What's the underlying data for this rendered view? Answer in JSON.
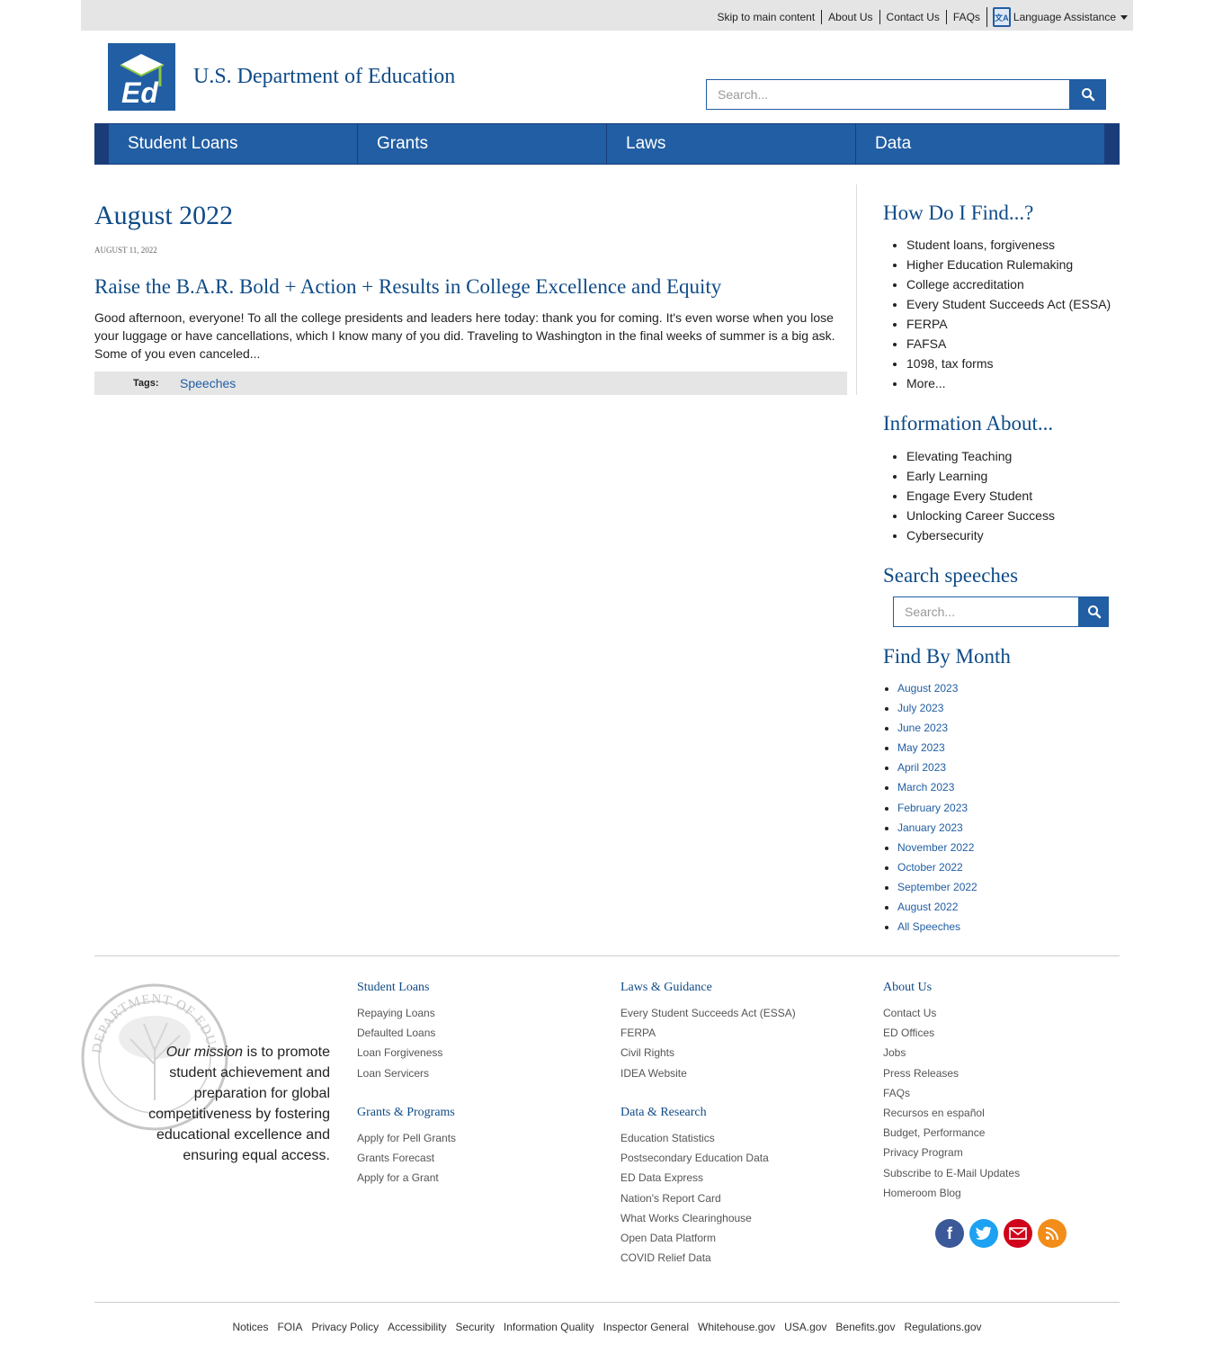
{
  "utility": {
    "links": [
      "Skip to main content",
      "About Us",
      "Contact Us",
      "FAQs"
    ],
    "language_label": "Language Assistance"
  },
  "header": {
    "logo_text": "Ed",
    "title": "U.S. Department of Education",
    "search_placeholder": "Search..."
  },
  "nav": [
    "Student Loans",
    "Grants",
    "Laws",
    "Data"
  ],
  "main": {
    "title": "August 2022",
    "date": "August 11, 2022",
    "post_title": "Raise the B.A.R. Bold + Action + Results in College Excellence and Equity",
    "post_body": "Good afternoon, everyone! To all the college presidents and leaders here today: thank you for coming. It's even worse when you lose your luggage or have cancellations, which I know many of you did.   Traveling to Washington in the final weeks of summer is a big ask. Some of you even canceled...",
    "tags_label": "Tags:",
    "tag": "Speeches"
  },
  "sidebar": {
    "find_heading": "How Do I Find...?",
    "find_items": [
      "Student loans, forgiveness",
      "Higher Education Rulemaking",
      "College accreditation",
      "Every Student Succeeds Act (ESSA)",
      "FERPA",
      "FAFSA",
      "1098, tax forms",
      "More..."
    ],
    "info_heading": "Information About...",
    "info_items": [
      "Elevating Teaching",
      "Early Learning",
      "Engage Every Student",
      "Unlocking Career Success",
      "Cybersecurity"
    ],
    "search_heading": "Search speeches",
    "search_placeholder": "Search...",
    "month_heading": "Find By Month",
    "months": [
      "August 2023",
      "July 2023",
      "June 2023",
      "May 2023",
      "April 2023",
      "March 2023",
      "February 2023",
      "January 2023",
      "November 2022",
      "October 2022",
      "September 2022",
      "August 2022",
      "All Speeches"
    ]
  },
  "footer": {
    "mission_em": "Our mission",
    "mission_rest": " is to promote student achievement and preparation for global competitiveness by fostering educational excellence and ensuring equal access.",
    "seal_text": "DEPARTMENT OF EDUCATION · UNITED STATES OF AMERICA",
    "student_loans": {
      "heading": "Student Loans",
      "items": [
        "Repaying Loans",
        "Defaulted Loans",
        "Loan Forgiveness",
        "Loan Servicers"
      ]
    },
    "grants": {
      "heading": "Grants & Programs",
      "items": [
        "Apply for Pell Grants",
        "Grants Forecast",
        "Apply for a Grant"
      ]
    },
    "laws": {
      "heading": "Laws & Guidance",
      "items": [
        "Every Student Succeeds Act (ESSA)",
        "FERPA",
        "Civil Rights",
        "IDEA Website"
      ]
    },
    "data": {
      "heading": "Data & Research",
      "items": [
        "Education Statistics",
        "Postsecondary Education Data",
        "ED Data Express",
        "Nation's Report Card",
        "What Works Clearinghouse",
        "Open Data Platform",
        "COVID Relief Data"
      ]
    },
    "about": {
      "heading": "About Us",
      "items": [
        "Contact Us",
        "ED Offices",
        "Jobs",
        "Press Releases",
        "FAQs",
        "Recursos en español",
        "Budget, Performance",
        "Privacy Program",
        "Subscribe to E-Mail Updates",
        "Homeroom Blog"
      ]
    },
    "social": {
      "facebook": "f",
      "colors": {
        "facebook": "#3b5998",
        "twitter": "#1da1f2",
        "email": "#d0021b",
        "rss": "#f28d1a"
      }
    },
    "bottom_links": [
      "Notices",
      "FOIA",
      "Privacy Policy",
      "Accessibility",
      "Security",
      "Information Quality",
      "Inspector General",
      "Whitehouse.gov",
      "USA.gov",
      "Benefits.gov",
      "Regulations.gov"
    ]
  },
  "colors": {
    "primary": "#215ea3",
    "navy": "#1a3d7a",
    "heading": "#0f4b87"
  }
}
